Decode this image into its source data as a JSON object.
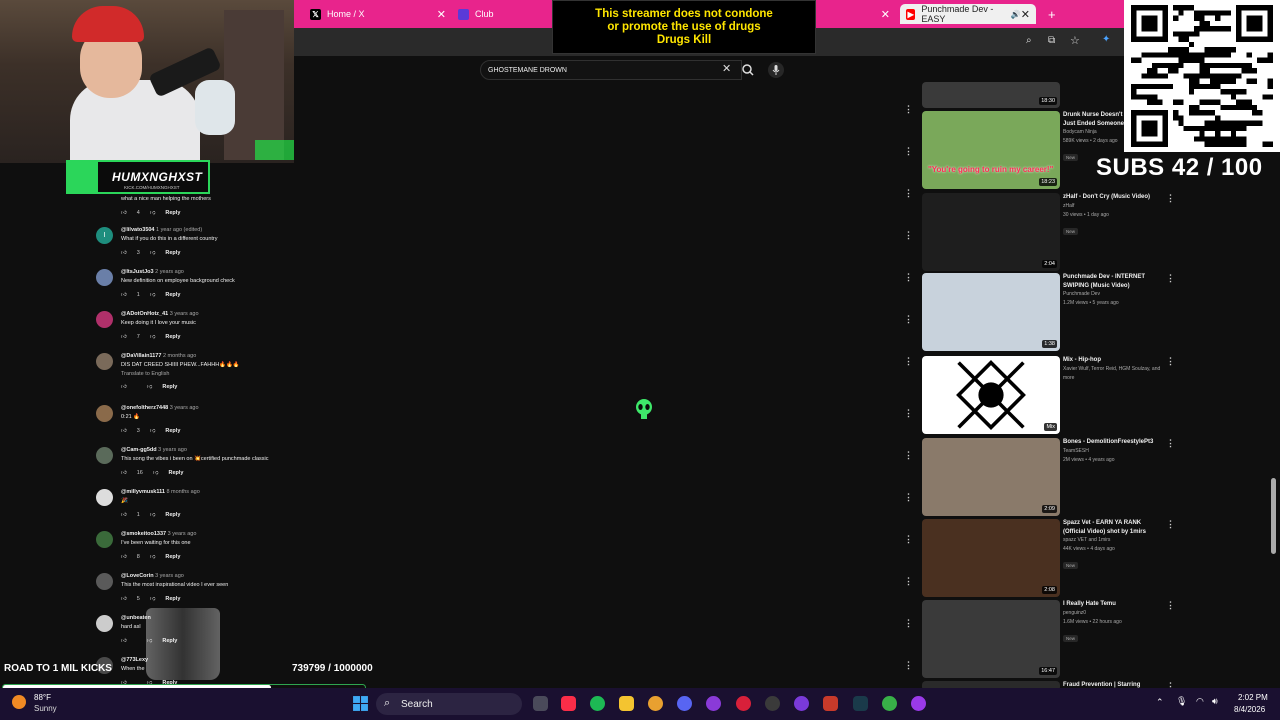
{
  "browser": {
    "tabs": [
      {
        "label": "Home / X",
        "icon": "x-logo-icon"
      },
      {
        "label": "Club",
        "icon": "club-icon"
      },
      {
        "label": "Punchmade Dev - EASY",
        "icon": "youtube-icon"
      }
    ]
  },
  "overlay": {
    "warning_lines": [
      "This streamer does not condone",
      "or promote the use of drugs",
      "Drugs Kill"
    ],
    "streamer_name": "HUMXNGHXST",
    "streamer_link": "KICK.COM/HUMXNGHXST",
    "road_label": "ROAD TO 1 MIL KICKS",
    "road_count": "739799 / 1000000",
    "road_progress": 0.7398,
    "subs": "SUBS 42 / 100"
  },
  "youtube": {
    "search_value": "GHOSTEMANE DROWN",
    "first_comment": {
      "text": "what a nice man helping the mothers",
      "likes": "4",
      "reply": "Reply"
    },
    "comments": [
      {
        "user": "@lilvato3504",
        "time": "1 year ago (edited)",
        "text": "What if you do this in a different country",
        "likes": "3",
        "avatar": "I",
        "color": "#1e8e7e"
      },
      {
        "user": "@ItsJustJo3",
        "time": "2 years ago",
        "text": "New definition on employee background check",
        "likes": "1",
        "avatar": "",
        "color": "#6a7fa8"
      },
      {
        "user": "@ADotOnHotz_41",
        "time": "3 years ago",
        "text": "Keep doing it I love your music",
        "likes": "7",
        "avatar": "",
        "color": "#b0306a"
      },
      {
        "user": "@DaVillain1177",
        "time": "2 months ago",
        "text": "DIS DAT CREED SHIIII PHEW...FAHHH🔥🔥🔥",
        "extra": "Translate to English",
        "likes": "",
        "avatar": "",
        "color": "#7a6a5a"
      },
      {
        "user": "@onefoltherz7448",
        "time": "3 years ago",
        "text": "0:21 🔥",
        "likes": "3",
        "avatar": "",
        "color": "#8a6a4a"
      },
      {
        "user": "@Cam-gg5dd",
        "time": "3 years ago",
        "text": "This song the vibes i been on 💥certified punchmade classic",
        "likes": "16",
        "avatar": "",
        "color": "#5a6a5a"
      },
      {
        "user": "@millyvmusk111",
        "time": "8 months ago",
        "text": "🎉",
        "likes": "1",
        "avatar": "",
        "color": "#dddddd"
      },
      {
        "user": "@smokeitoo1337",
        "time": "3 years ago",
        "text": "I've been waiting for this one",
        "likes": "8",
        "avatar": "",
        "color": "#3a6a3a"
      },
      {
        "user": "@LoveCorin",
        "time": "3 years ago",
        "text": "This the most inspirational video I ever seen",
        "likes": "5",
        "avatar": "",
        "color": "#5a5a5a"
      },
      {
        "user": "@unbeaten",
        "time": "",
        "text": "hard asl",
        "likes": "",
        "avatar": "",
        "color": "#cccccc"
      },
      {
        "user": "@773Lexy",
        "time": "",
        "text": "When the",
        "likes": "",
        "avatar": "",
        "color": "#4a4a4a"
      }
    ],
    "reply_label": "Reply",
    "videos": [
      {
        "title": "",
        "channel": "",
        "stats": "",
        "badge": "",
        "duration": "18:30",
        "thumb": "#3a3a3a"
      },
      {
        "title": "Drunk Nurse Doesn't Realize She Just Ended Someone's Career",
        "channel": "Bodycam Ninja",
        "stats": "589K views • 2 days ago",
        "badge": "New",
        "duration": "18:23",
        "thumb": "#7aa85a",
        "caption": "\"You're going to ruin my career!\""
      },
      {
        "title": "zHalf - Don't Cry (Music Video)",
        "channel": "zHalf",
        "stats": "30 views • 1 day ago",
        "badge": "New",
        "duration": "2:04",
        "thumb": "#1e1e1e"
      },
      {
        "title": "Punchmade Dev - INTERNET SWIPING (Music Video)",
        "channel": "Punchmade Dev",
        "stats": "1.2M views • 5 years ago",
        "badge": "",
        "duration": "1:38",
        "thumb": "#c8d2dc"
      },
      {
        "title": "Mix - Hip-hop",
        "channel": "Xavier Wulf, Terror Reid, HGM Soulzay, and more",
        "stats": "",
        "badge": "",
        "duration": "Mix",
        "thumb": "#ffffff"
      },
      {
        "title": "Bones - DemolitionFreestylePt3",
        "channel": "TeamSESH",
        "stats": "2M views • 4 years ago",
        "badge": "",
        "duration": "2:09",
        "thumb": "#8a7a6a"
      },
      {
        "title": "Spazz Vet - EARN YA RANK (Official Video) shot by 1mirs",
        "channel": "spazz VET and 1mirs",
        "stats": "44K views • 4 days ago",
        "badge": "New",
        "duration": "2:08",
        "thumb": "#4a3020"
      },
      {
        "title": "I Really Hate Temu",
        "channel": "penguinz0",
        "stats": "1.6M views • 22 hours ago",
        "badge": "New",
        "duration": "16:47",
        "thumb": "#3a3a3a"
      },
      {
        "title": "Fraud Prevention | Starring",
        "channel": "",
        "stats": "",
        "badge": "",
        "duration": "",
        "thumb": "#2a2a2a"
      }
    ]
  },
  "taskbar": {
    "temperature": "88°F",
    "weather": "Sunny",
    "search_label": "Search",
    "time": "2:02 PM",
    "date": "8/4/2026"
  }
}
